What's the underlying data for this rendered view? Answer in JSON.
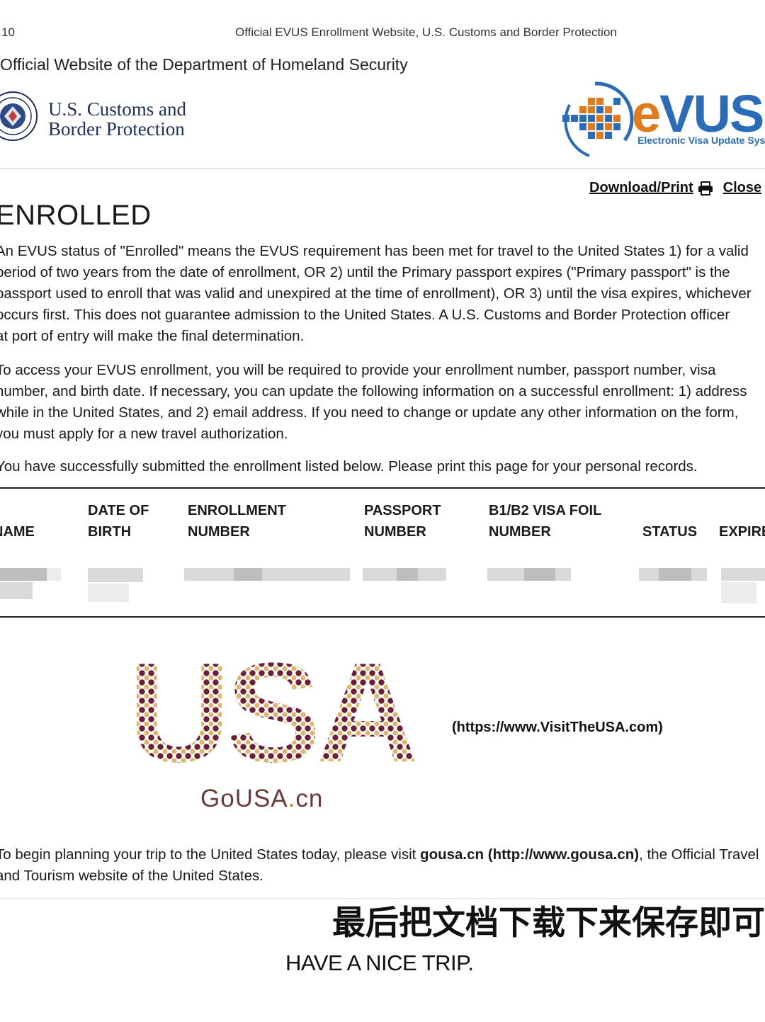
{
  "print_header": {
    "page_number": "10",
    "title": "Official EVUS Enrollment Website, U.S. Customs and Border Protection"
  },
  "banner": "Official Website of the Department of Homeland Security",
  "agency": {
    "line1": "U.S. Customs and",
    "line2": "Border Protection",
    "seal_icon": "dhs-seal-icon"
  },
  "evus": {
    "word_e": "e",
    "word_rest": "VUS",
    "tagline": "Electronic Visa Update System",
    "colors": {
      "blue": "#2a6cb8",
      "orange": "#e07a1a"
    }
  },
  "toolbar": {
    "download_label": "Download/Print",
    "close_label": "Close"
  },
  "status_title": "ENROLLED",
  "paragraphs": {
    "p1": [
      "An EVUS status of \"Enrolled\" means the EVUS requirement has been met for travel to the United States 1) for a valid",
      "period of two years from the date of enrollment, OR 2) until the Primary passport expires (\"Primary passport\" is the",
      "passport used to enroll that was valid and unexpired at the time of enrollment), OR 3) until the visa expires, whichever",
      "occurs first. This does not guarantee admission to the United States. A U.S. Customs and Border Protection officer",
      "at port of entry will make the final determination."
    ],
    "p2": [
      "To access your EVUS enrollment, you will be required to provide your enrollment number, passport number, visa",
      "number, and birth date. If necessary, you can update the following information on a successful enrollment: 1) address",
      "while in the United States, and 2) email address. If you need to change or update any other information on the form,",
      "you must apply for a new travel authorization."
    ],
    "p3": "You have successfully submitted the enrollment listed below. Please print this page for your personal records."
  },
  "table": {
    "headers": [
      {
        "line1": "",
        "line2": "NAME"
      },
      {
        "line1": "DATE OF",
        "line2": "BIRTH"
      },
      {
        "line1": "ENROLLMENT",
        "line2": "NUMBER"
      },
      {
        "line1": "PASSPORT",
        "line2": "NUMBER"
      },
      {
        "line1": "B1/B2 VISA FOIL",
        "line2": "NUMBER"
      },
      {
        "line1": "",
        "line2": "STATUS"
      },
      {
        "line1": "",
        "line2": "EXPIRES"
      }
    ]
  },
  "promo": {
    "logo_text": "USA",
    "logo_caption_a": "GoUSA",
    "logo_caption_dot": ".",
    "logo_caption_b": "cn",
    "link": "(https://www.VisitTheUSA.com)",
    "dot_colors": {
      "maroon": "#6e1f35",
      "gold": "#d8b05a"
    }
  },
  "footer": {
    "prefix": "To begin planning your trip to the United States today, please visit ",
    "site_name": "gousa.cn",
    "site_url": "(http://www.gousa.cn)",
    "suffix": ", the Official Travel",
    "line2": "and Tourism website of the United States."
  },
  "overlay_caption": "最后把文档下载下来保存即可",
  "closing": "HAVE A NICE TRIP."
}
